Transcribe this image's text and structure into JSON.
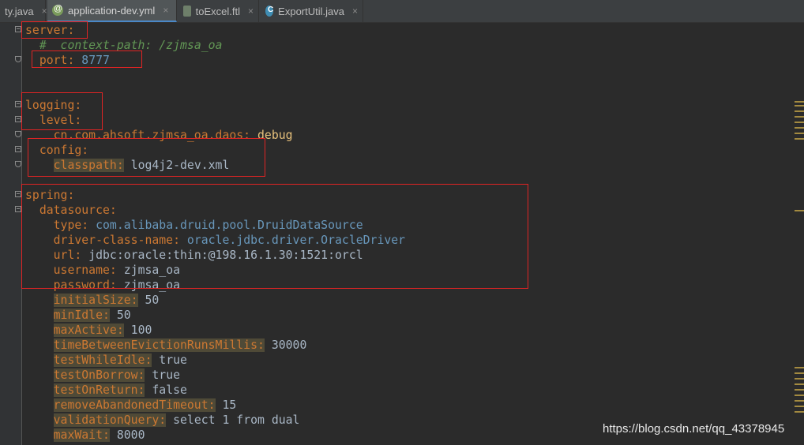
{
  "tabs": [
    {
      "label": "ty.java",
      "icon": "java-file-icon"
    },
    {
      "label": "application-dev.yml",
      "icon": "spring-yml-icon"
    },
    {
      "label": "toExcel.ftl",
      "icon": "ftl-file-icon"
    },
    {
      "label": "ExportUtil.java",
      "icon": "java-class-icon"
    }
  ],
  "tab_close": "×",
  "code": {
    "server": "server:",
    "comment": "#  context-path: /zjmsa_oa",
    "port_key": "port:",
    "port_val": "8777",
    "logging": "logging:",
    "level": "level:",
    "dao_key": "cn.com.ahsoft.zjmsa_oa.daos:",
    "dao_val": "debug",
    "config": "config:",
    "classpath_key": "classpath:",
    "classpath_val": "log4j2-dev.xml",
    "spring": "spring:",
    "datasource": "datasource:",
    "type_key": "type:",
    "type_val": "com.alibaba.druid.pool.DruidDataSource",
    "driver_key": "driver-class-name:",
    "driver_val": "oracle.jdbc.driver.OracleDriver",
    "url_key": "url:",
    "url_val": "jdbc:oracle:thin:@198.16.1.30:1521:orcl",
    "username_key": "username:",
    "username_val": "zjmsa_oa",
    "password_key": "password:",
    "password_val": "zjmsa_oa",
    "initialSize_key": "initialSize:",
    "initialSize_val": "50",
    "minIdle_key": "minIdle:",
    "minIdle_val": "50",
    "maxActive_key": "maxActive:",
    "maxActive_val": "100",
    "tber_key": "timeBetweenEvictionRunsMillis:",
    "tber_val": "30000",
    "twi_key": "testWhileIdle:",
    "twi_val": "true",
    "tob_key": "testOnBorrow:",
    "tob_val": "true",
    "tor_key": "testOnReturn:",
    "tor_val": "false",
    "rat_key": "removeAbandonedTimeout:",
    "rat_val": "15",
    "vq_key": "validationQuery:",
    "vq_val": "select 1 from dual",
    "mw_key": "maxWait:",
    "mw_val": "8000"
  },
  "watermark": "https://blog.csdn.net/qq_43378945",
  "colors": {
    "background": "#2b2b2b",
    "key": "#cc7832",
    "string": "#a9b7c6",
    "number": "#6897bb",
    "annotation_box": "#e02424"
  }
}
